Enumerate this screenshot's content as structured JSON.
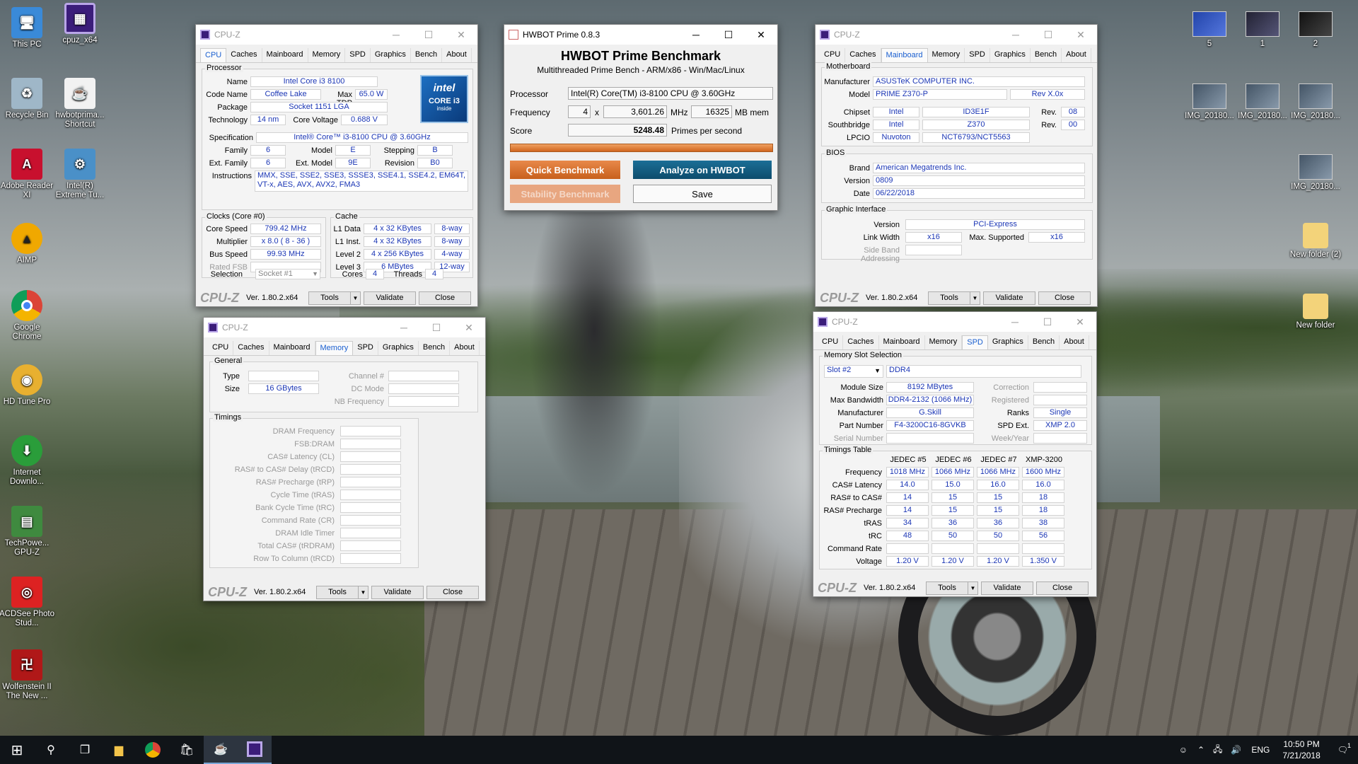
{
  "desktop_icons": [
    {
      "label": "This PC"
    },
    {
      "label": "cpuz_x64"
    },
    {
      "label": "Recycle Bin"
    },
    {
      "label": "hwbotprima... Shortcut"
    },
    {
      "label": "Adobe Reader XI"
    },
    {
      "label": "Intel(R) Extreme Tu..."
    },
    {
      "label": "AIMP"
    },
    {
      "label": "Google Chrome"
    },
    {
      "label": "HD Tune Pro"
    },
    {
      "label": "Internet Downlo..."
    },
    {
      "label": "TechPowe... GPU-Z"
    },
    {
      "label": "ACDSee Photo Stud..."
    },
    {
      "label": "Wolfenstein II The New ..."
    }
  ],
  "desktop_right_icons": [
    {
      "label": "5"
    },
    {
      "label": "1"
    },
    {
      "label": "2"
    },
    {
      "label": "IMG_20180..."
    },
    {
      "label": "IMG_20180..."
    },
    {
      "label": "IMG_20180..."
    },
    {
      "label": "IMG_20180..."
    },
    {
      "label": "New folder (2)"
    },
    {
      "label": "New folder"
    }
  ],
  "cpuz_common": {
    "title": "CPU-Z",
    "tabs": [
      "CPU",
      "Caches",
      "Mainboard",
      "Memory",
      "SPD",
      "Graphics",
      "Bench",
      "About"
    ],
    "logo": "CPU-Z",
    "version": "Ver. 1.80.2.x64",
    "tools": "Tools",
    "validate": "Validate",
    "close": "Close"
  },
  "cpu_tab": {
    "processor_group": "Processor",
    "name_l": "Name",
    "name": "Intel Core i3 8100",
    "codename_l": "Code Name",
    "codename": "Coffee Lake",
    "maxtdp_l": "Max TDP",
    "maxtdp": "65.0 W",
    "package_l": "Package",
    "package": "Socket 1151 LGA",
    "technology_l": "Technology",
    "technology": "14 nm",
    "corevoltage_l": "Core Voltage",
    "corevoltage": "0.688 V",
    "spec_l": "Specification",
    "spec": "Intel® Core™ i3-8100 CPU @ 3.60GHz",
    "family_l": "Family",
    "family": "6",
    "model_l": "Model",
    "model": "E",
    "stepping_l": "Stepping",
    "stepping": "B",
    "extfamily_l": "Ext. Family",
    "extfamily": "6",
    "extmodel_l": "Ext. Model",
    "extmodel": "9E",
    "revision_l": "Revision",
    "revision": "B0",
    "instructions_l": "Instructions",
    "instructions": "MMX, SSE, SSE2, SSE3, SSSE3, SSE4.1, SSE4.2, EM64T, VT-x, AES, AVX, AVX2, FMA3",
    "badge_brand": "intel",
    "badge_line": "CORE i3",
    "badge_sub": "inside",
    "clocks_group": "Clocks (Core #0)",
    "corespeed_l": "Core Speed",
    "corespeed": "799.42 MHz",
    "multiplier_l": "Multiplier",
    "multiplier": "x 8.0 ( 8 - 36 )",
    "busspeed_l": "Bus Speed",
    "busspeed": "99.93 MHz",
    "ratedfsb_l": "Rated FSB",
    "cache_group": "Cache",
    "l1d_l": "L1 Data",
    "l1d": "4 x 32 KBytes",
    "l1d_w": "8-way",
    "l1i_l": "L1 Inst.",
    "l1i": "4 x 32 KBytes",
    "l1i_w": "8-way",
    "l2_l": "Level 2",
    "l2": "4 x 256 KBytes",
    "l2_w": "4-way",
    "l3_l": "Level 3",
    "l3": "6 MBytes",
    "l3_w": "12-way",
    "selection_l": "Selection",
    "selection": "Socket #1",
    "cores_l": "Cores",
    "cores": "4",
    "threads_l": "Threads",
    "threads": "4"
  },
  "memory_tab": {
    "general_group": "General",
    "type_l": "Type",
    "size_l": "Size",
    "size": "16 GBytes",
    "channel_l": "Channel #",
    "dcmode_l": "DC Mode",
    "nbfreq_l": "NB Frequency",
    "timings_group": "Timings",
    "timing_labels": [
      "DRAM Frequency",
      "FSB:DRAM",
      "CAS# Latency (CL)",
      "RAS# to CAS# Delay (tRCD)",
      "RAS# Precharge (tRP)",
      "Cycle Time (tRAS)",
      "Bank Cycle Time (tRC)",
      "Command Rate (CR)",
      "DRAM Idle Timer",
      "Total CAS# (tRDRAM)",
      "Row To Column (tRCD)"
    ]
  },
  "hwbot": {
    "title": "HWBOT Prime 0.8.3",
    "heading": "HWBOT Prime Benchmark",
    "subheading": "Multithreaded Prime Bench - ARM/x86 - Win/Mac/Linux",
    "processor_l": "Processor",
    "processor": "Intel(R) Core(TM) i3-8100 CPU @ 3.60GHz",
    "frequency_l": "Frequency",
    "cores": "4",
    "x": "x",
    "frequency": "3,601.26",
    "mhz": "MHz",
    "mem": "16325",
    "mem_l": "MB mem",
    "score_l": "Score",
    "score": "5248.48",
    "score_unit": "Primes per second",
    "progress": 1.0,
    "quick": "Quick Benchmark",
    "analyze": "Analyze on HWBOT",
    "stability": "Stability Benchmark",
    "save": "Save"
  },
  "mainboard_tab": {
    "motherboard_group": "Motherboard",
    "manufacturer_l": "Manufacturer",
    "manufacturer": "ASUSTeK COMPUTER INC.",
    "model_l": "Model",
    "model": "PRIME Z370-P",
    "model_rev": "Rev X.0x",
    "chipset_l": "Chipset",
    "chipset_vendor": "Intel",
    "chipset": "ID3E1F",
    "chipset_rev_l": "Rev.",
    "chipset_rev": "08",
    "southbridge_l": "Southbridge",
    "sb_vendor": "Intel",
    "sb": "Z370",
    "sb_rev_l": "Rev.",
    "sb_rev": "00",
    "lpcio_l": "LPCIO",
    "lpcio_vendor": "Nuvoton",
    "lpcio": "NCT6793/NCT5563",
    "bios_group": "BIOS",
    "brand_l": "Brand",
    "brand": "American Megatrends Inc.",
    "version_l": "Version",
    "version": "0809",
    "date_l": "Date",
    "date": "06/22/2018",
    "gi_group": "Graphic Interface",
    "gi_version_l": "Version",
    "gi_version": "PCI-Express",
    "linkwidth_l": "Link Width",
    "linkwidth": "x16",
    "maxsupported_l": "Max. Supported",
    "maxsupported": "x16",
    "sideband_l": "Side Band Addressing"
  },
  "spd_tab": {
    "slot_group": "Memory Slot Selection",
    "slot": "Slot #2",
    "ddr": "DDR4",
    "modulesize_l": "Module Size",
    "modulesize": "8192 MBytes",
    "maxbw_l": "Max Bandwidth",
    "maxbw": "DDR4-2132 (1066 MHz)",
    "manufacturer_l": "Manufacturer",
    "manufacturer": "G.Skill",
    "partnumber_l": "Part Number",
    "partnumber": "F4-3200C16-8GVKB",
    "serial_l": "Serial Number",
    "correction_l": "Correction",
    "registered_l": "Registered",
    "ranks_l": "Ranks",
    "ranks": "Single",
    "spdext_l": "SPD Ext.",
    "spdext": "XMP 2.0",
    "weekyear_l": "Week/Year",
    "timings_group": "Timings Table",
    "columns": [
      "JEDEC #5",
      "JEDEC #6",
      "JEDEC #7",
      "XMP-3200"
    ],
    "rows": [
      {
        "label": "Frequency",
        "values": [
          "1018 MHz",
          "1066 MHz",
          "1066 MHz",
          "1600 MHz"
        ]
      },
      {
        "label": "CAS# Latency",
        "values": [
          "14.0",
          "15.0",
          "16.0",
          "16.0"
        ]
      },
      {
        "label": "RAS# to CAS#",
        "values": [
          "14",
          "15",
          "15",
          "18"
        ]
      },
      {
        "label": "RAS# Precharge",
        "values": [
          "14",
          "15",
          "15",
          "18"
        ]
      },
      {
        "label": "tRAS",
        "values": [
          "34",
          "36",
          "36",
          "38"
        ]
      },
      {
        "label": "tRC",
        "values": [
          "48",
          "50",
          "50",
          "56"
        ]
      },
      {
        "label": "Command Rate",
        "values": [
          "",
          "",
          "",
          ""
        ]
      },
      {
        "label": "Voltage",
        "values": [
          "1.20 V",
          "1.20 V",
          "1.20 V",
          "1.350 V"
        ]
      }
    ]
  },
  "taskbar": {
    "lang": "ENG",
    "time": "10:50 PM",
    "date": "7/21/2018",
    "notifications": "1"
  }
}
